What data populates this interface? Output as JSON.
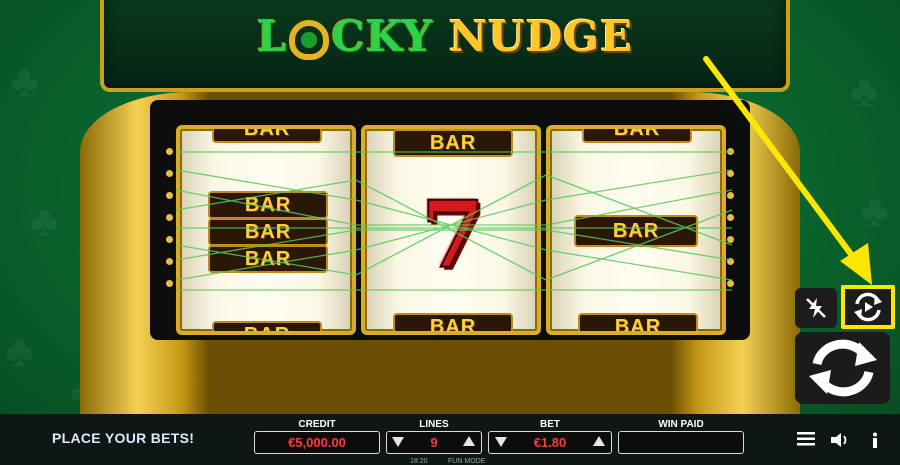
{
  "game": {
    "logo_part1": "L",
    "logo_part2": "CKY",
    "logo_part3": "NUDGE"
  },
  "reels": [
    {
      "symbols": [
        "BAR",
        "BAR",
        "BAR",
        "BAR",
        "BAR"
      ]
    },
    {
      "symbols": [
        "BAR",
        "7",
        "BAR"
      ]
    },
    {
      "symbols": [
        "BAR",
        "BAR",
        "BAR"
      ]
    }
  ],
  "bottom_bar": {
    "status": "PLACE YOUR BETS!",
    "credit_label": "CREDIT",
    "credit_value": "€5,000.00",
    "lines_label": "LINES",
    "lines_value": "9",
    "bet_label": "BET",
    "bet_value": "€1.80",
    "win_label": "WIN PAID",
    "win_value": "",
    "clock": "18:20",
    "mode": "FUN MODE"
  },
  "icons": {
    "turbo": "lightning-off-icon",
    "autoplay": "autoplay-icon",
    "spin": "spin-icon",
    "menu": "menu-icon",
    "sound": "speaker-icon",
    "info": "info-icon"
  },
  "colors": {
    "highlight": "#ffe600",
    "gold": "#d9ad2c",
    "value_red": "#ff3a3a"
  }
}
